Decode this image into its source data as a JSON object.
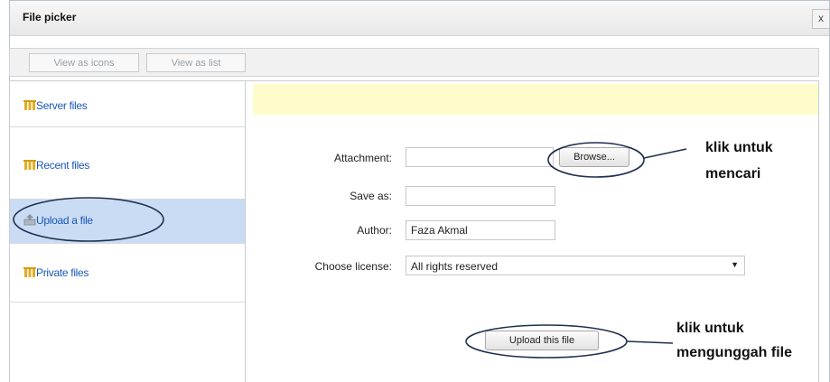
{
  "dialog": {
    "title": "File picker",
    "close_glyph": "x"
  },
  "toolbar": {
    "view_icons": "View as icons",
    "view_list": "View as list"
  },
  "sidebar": {
    "items": [
      {
        "label": "Server files",
        "icon": "repository-icon"
      },
      {
        "label": "Recent files",
        "icon": "repository-icon"
      },
      {
        "label": "Upload a file",
        "icon": "upload-icon",
        "selected": true
      },
      {
        "label": "Private files",
        "icon": "repository-icon"
      }
    ]
  },
  "form": {
    "attachment_label": "Attachment:",
    "browse_label": "Browse...",
    "saveas_label": "Save as:",
    "saveas_value": "",
    "author_label": "Author:",
    "author_value": "Faza Akmal",
    "license_label": "Choose license:",
    "license_value": "All rights reserved",
    "upload_label": "Upload this file"
  },
  "annotations": {
    "browse_line1": "klik untuk",
    "browse_line2": "mencari",
    "upload_line1": "klik untuk",
    "upload_line2": "mengunggah file"
  },
  "colors": {
    "link": "#1a57b5",
    "selected_bg": "#c9dcf3",
    "notice_bg": "#fffccc",
    "callout": "#1f2f4f"
  }
}
